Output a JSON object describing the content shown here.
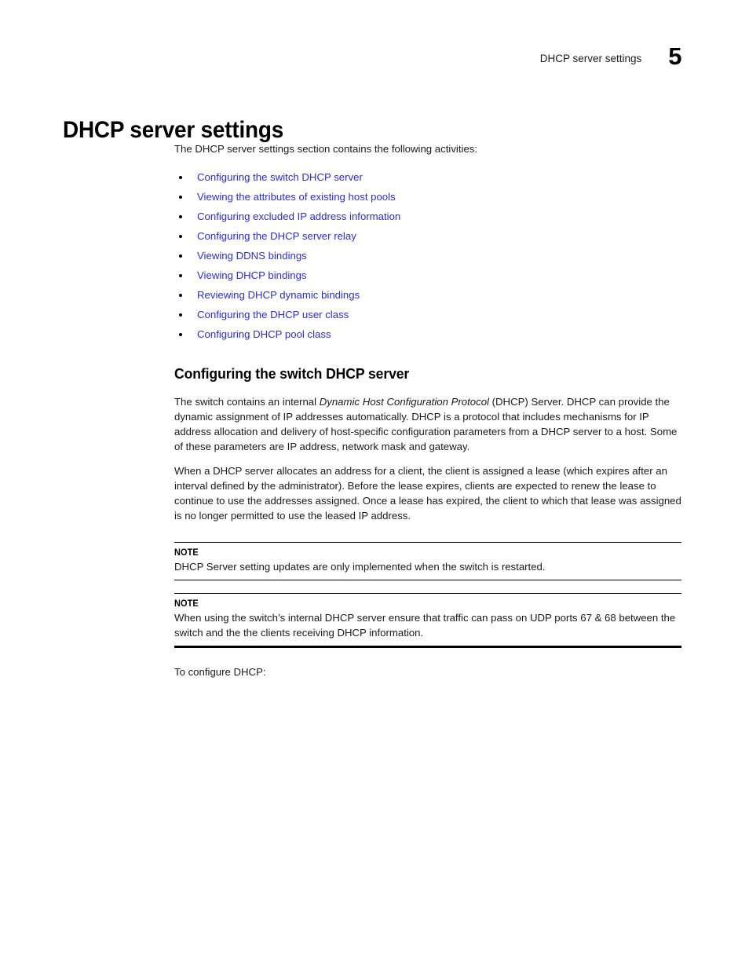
{
  "header": {
    "title": "DHCP server settings",
    "chapter_number": "5"
  },
  "chapter_title": "DHCP server settings",
  "intro_paragraph": "The DHCP server settings section contains the following activities:",
  "link_list": [
    {
      "label": "Configuring the switch DHCP server"
    },
    {
      "label": "Viewing the attributes of existing host pools"
    },
    {
      "label": "Configuring excluded IP address information"
    },
    {
      "label": "Configuring the DHCP server relay"
    },
    {
      "label": "Viewing DDNS bindings"
    },
    {
      "label": "Viewing DHCP bindings"
    },
    {
      "label": "Reviewing DHCP dynamic bindings"
    },
    {
      "label": "Configuring the DHCP user class"
    },
    {
      "label": "Configuring DHCP pool class"
    }
  ],
  "section": {
    "heading": "Configuring the switch DHCP server",
    "paragraph_1": {
      "before_italic": "The switch contains an internal ",
      "italic": "Dynamic Host Configuration Protocol",
      "after_italic": " (DHCP) Server. DHCP can provide the dynamic assignment of IP addresses automatically. DHCP is a protocol that includes mechanisms for IP address allocation and delivery of host-specific configuration parameters from a DHCP server to a host. Some of these parameters are IP address, network mask and gateway."
    },
    "paragraph_2": "When a DHCP server allocates an address for a client, the client is assigned a lease (which expires after an interval defined by the administrator). Before the lease expires, clients are expected to renew the lease to continue to use the addresses assigned. Once a lease has expired, the client to which that lease was assigned is no longer permitted to use the leased IP address."
  },
  "notes": [
    {
      "label": "NOTE",
      "text": "DHCP Server setting updates are only implemented when the switch is restarted."
    },
    {
      "label": "NOTE",
      "text": "When using the switch’s internal DHCP server ensure that traffic can pass on UDP ports 67 & 68 between the switch and the the clients receiving DHCP information."
    }
  ],
  "closing_paragraph": "To configure DHCP:",
  "colors": {
    "link": "#2a2ae8",
    "text": "#1a1a1a",
    "rule": "#000000"
  }
}
